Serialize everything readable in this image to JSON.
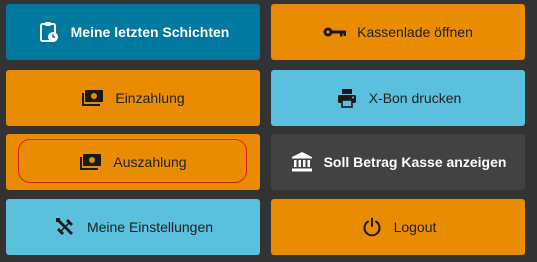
{
  "buttons": {
    "my_last_shifts": {
      "label": "Meine letzten Schichten",
      "icon": "clipboard-clock-icon"
    },
    "open_cash_drawer": {
      "label": "Kassenlade öffnen",
      "icon": "key-icon"
    },
    "deposit": {
      "label": "Einzahlung",
      "icon": "money-bill-icon"
    },
    "print_x_receipt": {
      "label": "X-Bon drucken",
      "icon": "printer-icon"
    },
    "withdrawal": {
      "label": "Auszahlung",
      "icon": "money-bill-icon"
    },
    "show_target_cash": {
      "label": "Soll Betrag Kasse anzeigen",
      "icon": "bank-icon"
    },
    "my_settings": {
      "label": "Meine Einstellungen",
      "icon": "tools-icon"
    },
    "logout": {
      "label": "Logout",
      "icon": "power-icon"
    }
  },
  "colors": {
    "teal": "#00789f",
    "orange": "#ea8c00",
    "light_blue": "#5bc0de",
    "dark": "#424242",
    "focus_ring": "#e02020"
  }
}
